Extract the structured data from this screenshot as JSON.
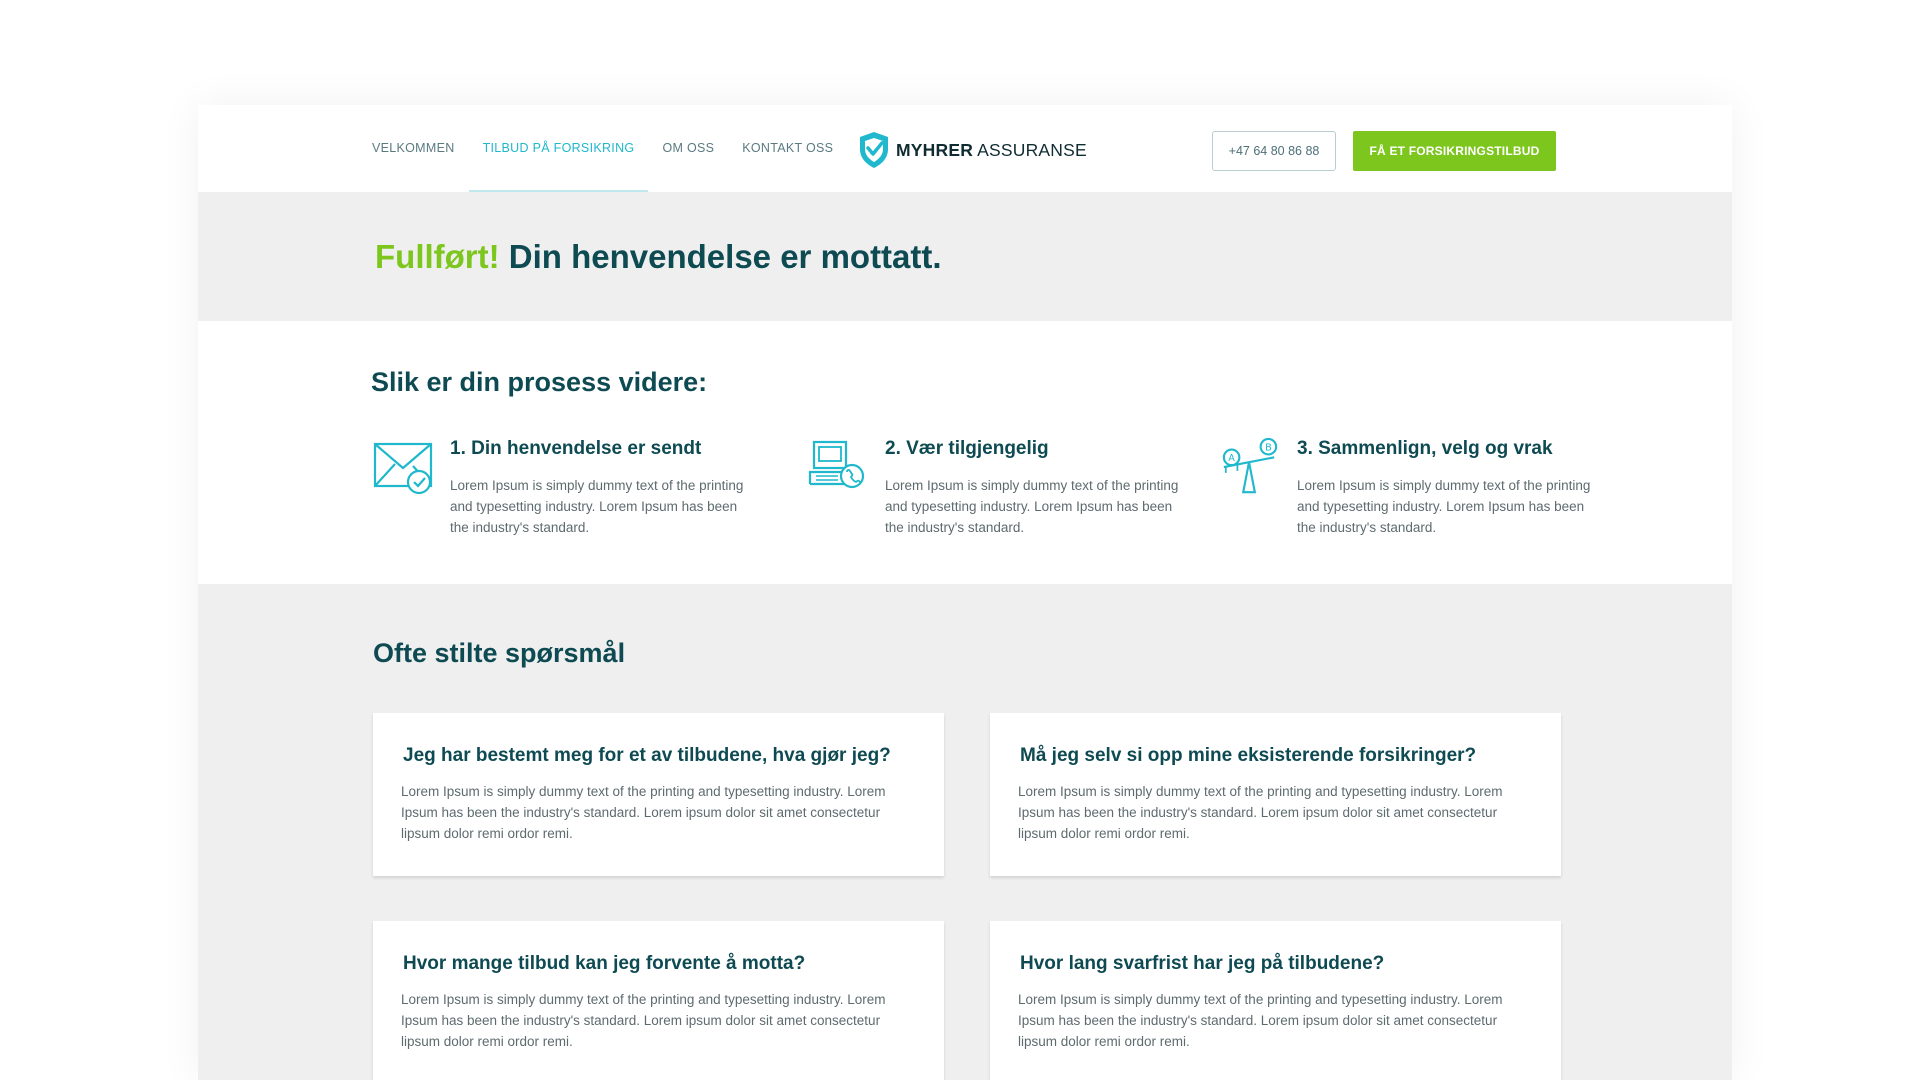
{
  "colors": {
    "accent_teal": "#1fb8cc",
    "brand_green": "#7cc61e",
    "heading_dark": "#0e4a52",
    "panel_grey": "#efefef"
  },
  "header": {
    "nav": [
      {
        "label": "VELKOMMEN",
        "active": false
      },
      {
        "label": "TILBUD PÅ FORSIKRING",
        "active": true
      },
      {
        "label": "OM OSS",
        "active": false
      },
      {
        "label": "KONTAKT OSS",
        "active": false
      }
    ],
    "logo": {
      "brand_bold": "MYHRER",
      "brand_rest": " ASSURANSE",
      "icon": "shield-check-icon"
    },
    "phone_label": "+47 64 80 86 88",
    "cta_label": "FÅ ET FORSIKRINGSTILBUD"
  },
  "banner": {
    "highlight": "Fullført!",
    "title": " Din henvendelse er mottatt."
  },
  "process": {
    "title": "Slik er din prosess videre:",
    "steps": [
      {
        "number": "1.",
        "title": " Din henvendelse er sendt",
        "text": "Lorem Ipsum is simply dummy text of the printing and typesetting industry. Lorem Ipsum has been the industry's standard.",
        "icon": "envelope-check-icon"
      },
      {
        "number": "2.",
        "title": " Vær tilgjengelig",
        "text": "Lorem Ipsum is simply dummy text of the printing and typesetting industry. Lorem Ipsum has been the industry's standard.",
        "icon": "laptop-phone-icon"
      },
      {
        "number": "3.",
        "title": " Sammenlign, velg og vrak",
        "text": "Lorem Ipsum is simply dummy text of the printing and typesetting industry. Lorem Ipsum has been the industry's standard.",
        "icon": "balance-scale-icon"
      }
    ]
  },
  "faq": {
    "title": "Ofte stilte spørsmål",
    "items": [
      {
        "question": "Jeg har bestemt meg for et av tilbudene, hva gjør jeg?",
        "answer": "Lorem Ipsum is simply dummy text of the printing and typesetting industry. Lorem Ipsum has been the industry's standard. Lorem ipsum dolor sit amet consectetur lipsum dolor remi ordor remi."
      },
      {
        "question": "Må jeg selv si opp mine eksisterende forsikringer?",
        "answer": "Lorem Ipsum is simply dummy text of the printing and typesetting industry. Lorem Ipsum has been the industry's standard. Lorem ipsum dolor sit amet consectetur lipsum dolor remi ordor remi."
      },
      {
        "question": "Hvor mange tilbud kan jeg forvente å motta?",
        "answer": "Lorem Ipsum is simply dummy text of the printing and typesetting industry. Lorem Ipsum has been the industry's standard. Lorem ipsum dolor sit amet consectetur lipsum dolor remi ordor remi."
      },
      {
        "question": "Hvor lang svarfrist har jeg på tilbudene?",
        "answer": "Lorem Ipsum is simply dummy text of the printing and typesetting industry. Lorem Ipsum has been the industry's standard. Lorem ipsum dolor sit amet consectetur lipsum dolor remi ordor remi."
      }
    ]
  }
}
